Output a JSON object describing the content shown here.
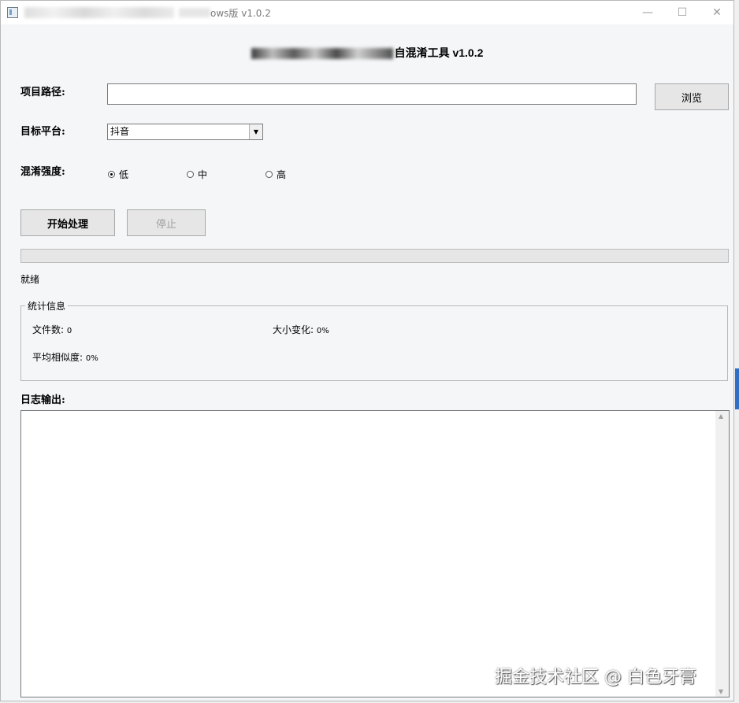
{
  "window": {
    "title": "ows版 v1.0.2",
    "controls": {
      "minimize": "—",
      "maximize": "☐",
      "close": "✕"
    }
  },
  "header": {
    "title": "自混淆工具 v1.0.2"
  },
  "form": {
    "project_path_label": "项目路径:",
    "project_path_value": "",
    "browse_label": "浏览",
    "platform_label": "目标平台:",
    "platform_selected": "抖音",
    "strength_label": "混淆强度:",
    "strength_options": [
      {
        "label": "低",
        "checked": true
      },
      {
        "label": "中",
        "checked": false
      },
      {
        "label": "高",
        "checked": false
      }
    ]
  },
  "actions": {
    "start_label": "开始处理",
    "stop_label": "停止",
    "stop_enabled": false
  },
  "progress": {
    "value_percent": 0
  },
  "status": {
    "text": "就绪"
  },
  "stats": {
    "legend": "统计信息",
    "file_count_label": "文件数:",
    "file_count_value": "0",
    "size_change_label": "大小变化:",
    "size_change_value": "0%",
    "avg_similarity_label": "平均相似度:",
    "avg_similarity_value": "0%"
  },
  "log": {
    "label": "日志输出:",
    "content": ""
  },
  "watermark": {
    "text": "掘金技术社区 @ 白色牙膏"
  },
  "colors": {
    "accent": "#2f6fc6",
    "progress_fill": "#06b025"
  }
}
